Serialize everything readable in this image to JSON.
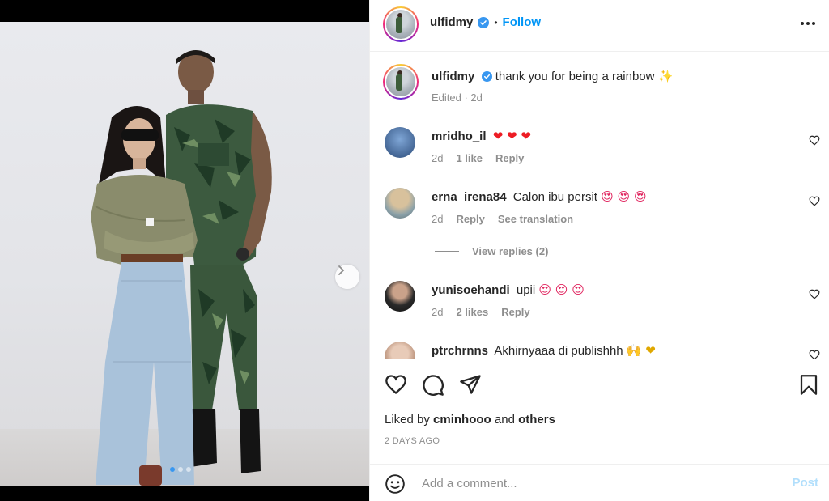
{
  "post": {
    "author": "ulfidmy",
    "follow_label": "Follow",
    "separator": "•",
    "caption": "thank you for being a rainbow",
    "caption_emoji": "✨",
    "caption_meta": "Edited · 2d",
    "carousel": {
      "slide_count": 3,
      "active_slide": 1
    }
  },
  "comments": [
    {
      "username": "mridho_il",
      "text": "",
      "emoji": "❤ ❤ ❤",
      "time": "2d",
      "likes": "1 like",
      "reply": "Reply"
    },
    {
      "username": "erna_irena84",
      "text": "Calon ibu persit",
      "emoji": "😍 😍 😍",
      "time": "2d",
      "reply": "Reply",
      "translate": "See translation"
    },
    {
      "username": "yunisoehandi",
      "text": "upii",
      "emoji": "😍 😍 😍",
      "time": "2d",
      "likes": "2 likes",
      "reply": "Reply"
    },
    {
      "username": "ptrchrnns",
      "text": "Akhirnyaaa di publishhh",
      "emoji": "🙌 ❤"
    }
  ],
  "view_replies": "View replies (2)",
  "likes": {
    "prefix": "Liked by",
    "user": "cminhooo",
    "conj": "and",
    "others": "others"
  },
  "timestamp": "2 DAYS AGO",
  "add_comment": {
    "placeholder": "Add a comment...",
    "post_label": "Post"
  },
  "icons": {
    "more": "more-options-icon",
    "verified": "verified-badge-icon",
    "like": "heart-icon",
    "comment": "comment-icon",
    "share": "share-icon",
    "save": "bookmark-icon",
    "emoji": "smiley-icon",
    "next": "chevron-right-icon"
  },
  "colors": {
    "accent": "#0095f6",
    "verified": "#3897f0",
    "heart": "#ed1c24",
    "post_disabled": "#b2dffc"
  }
}
